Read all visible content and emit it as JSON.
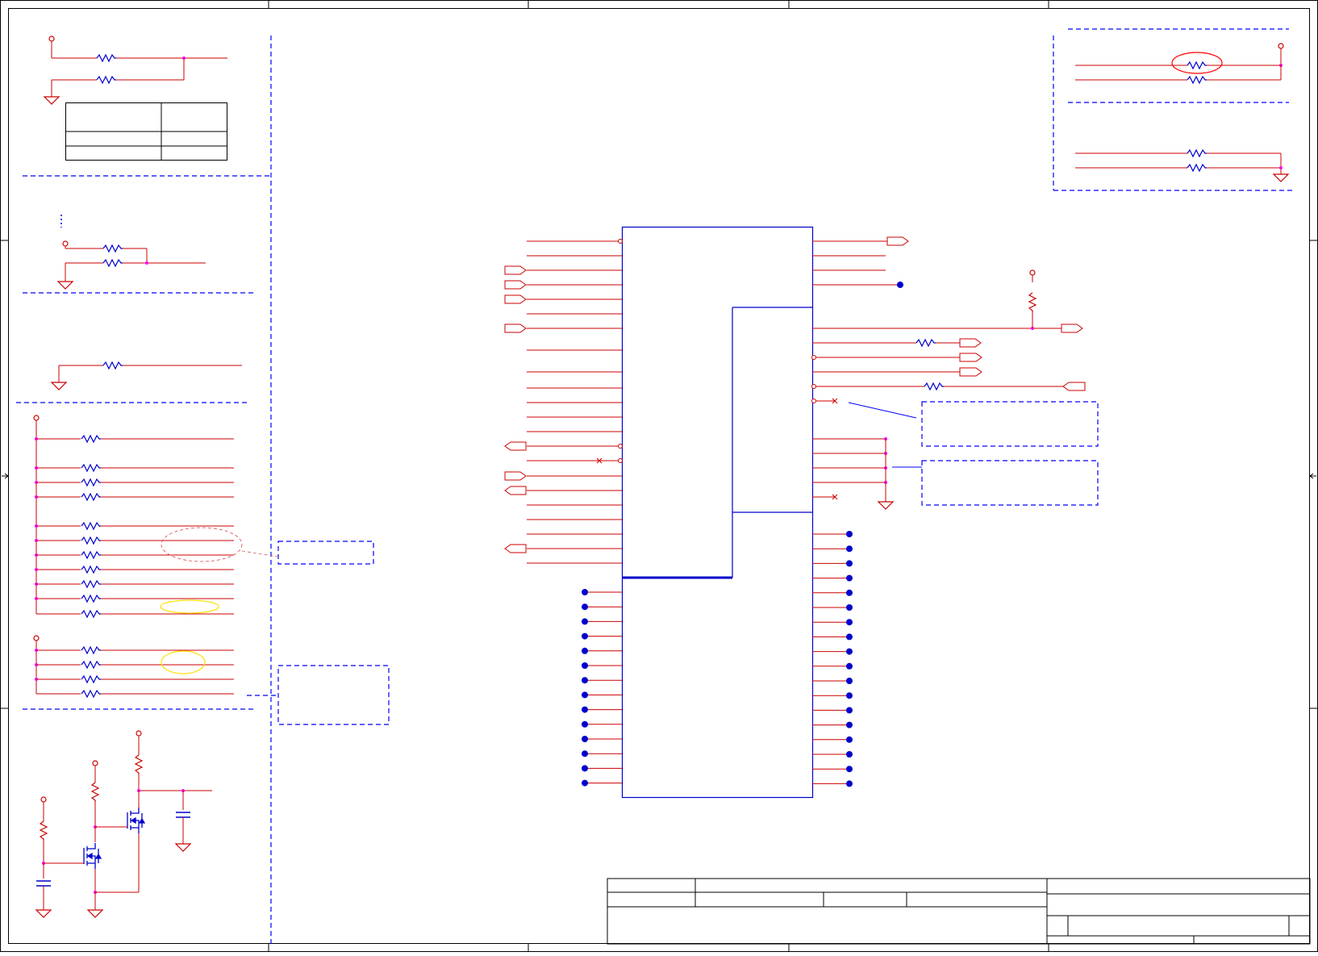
{
  "colors": {
    "wire": "#cc0000",
    "component": "#0000cc",
    "junction": "#ff00ff",
    "frame": "#000000",
    "note_box": "#0000ff",
    "highlight_red": "#ff0000",
    "highlight_yellow": "#ffdd00"
  },
  "schematic": {
    "title_block": {
      "cells": []
    }
  },
  "icons": [
    "ground-icon",
    "power-rail-icon",
    "resistor-icon",
    "capacitor-icon",
    "mosfet-icon",
    "off-page-connector-icon",
    "no-connect-icon"
  ]
}
